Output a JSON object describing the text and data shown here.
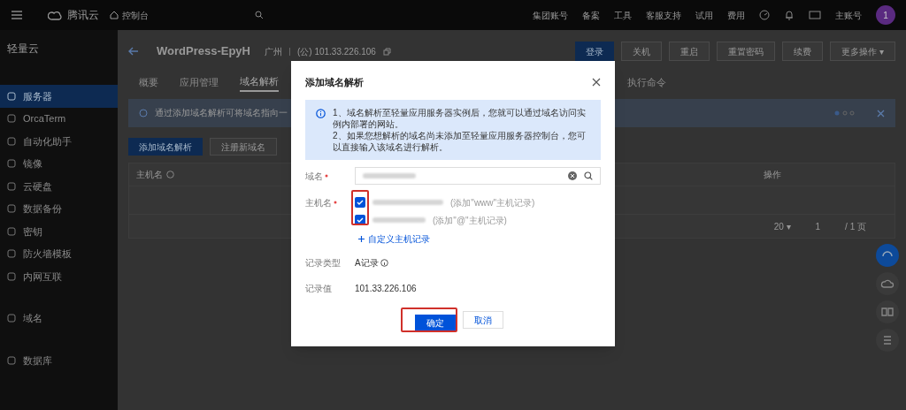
{
  "topbar": {
    "logo": "腾讯云",
    "console": "控制台",
    "nav": [
      "集团账号",
      "备案",
      "工具",
      "客服支持",
      "试用",
      "费用"
    ],
    "account": "主账号",
    "avatar": "1"
  },
  "sidebar": {
    "title": "轻量云",
    "items": [
      {
        "kind": "item",
        "label": "服务器",
        "selected": true
      },
      {
        "kind": "item",
        "label": "OrcaTerm",
        "selected": false
      },
      {
        "kind": "item",
        "label": "自动化助手",
        "selected": false
      },
      {
        "kind": "item",
        "label": "镜像",
        "selected": false
      },
      {
        "kind": "item",
        "label": "云硬盘",
        "selected": false
      },
      {
        "kind": "item",
        "label": "数据备份",
        "selected": false
      },
      {
        "kind": "item",
        "label": "密钥",
        "selected": false
      },
      {
        "kind": "item",
        "label": "防火墙模板",
        "selected": false
      },
      {
        "kind": "item",
        "label": "内网互联",
        "selected": false
      },
      {
        "kind": "section"
      },
      {
        "kind": "item",
        "label": "域名",
        "selected": false
      },
      {
        "kind": "section"
      },
      {
        "kind": "item",
        "label": "数据库",
        "selected": false
      }
    ]
  },
  "instance": {
    "name": "WordPress-EpyH",
    "region": "广州",
    "ip": "(公) 101.33.226.106"
  },
  "actions": [
    {
      "label": "登录",
      "primary": true
    },
    {
      "label": "关机",
      "primary": false
    },
    {
      "label": "重启",
      "primary": false
    },
    {
      "label": "重置密码",
      "primary": false
    },
    {
      "label": "续费",
      "primary": false
    },
    {
      "label": "更多操作 ▾",
      "primary": false
    }
  ],
  "tabs": [
    {
      "label": "概要",
      "selected": false
    },
    {
      "label": "应用管理",
      "selected": false
    },
    {
      "label": "域名解析",
      "selected": true
    },
    {
      "label": "执行命令",
      "selected": false
    }
  ],
  "banner": {
    "text": "通过添加域名解析可将域名指向一"
  },
  "toolbar": [
    {
      "label": "添加域名解析",
      "primary": true
    },
    {
      "label": "注册新域名",
      "primary": false
    }
  ],
  "table": {
    "columns": [
      "主机名",
      "操作"
    ],
    "pagination": {
      "page_size": "20 ▾",
      "page": "1",
      "pages": "/ 1 页"
    }
  },
  "dialog": {
    "title": "添加域名解析",
    "info": [
      "1、域名解析至轻量应用服务器实例后，您就可以通过域名访问实例内部署的网站。",
      "2、如果您想解析的域名尚未添加至轻量应用服务器控制台，您可以直接输入该域名进行解析。"
    ],
    "domain_label": "域名",
    "host_label": "主机名",
    "hosts": [
      {
        "checked": true,
        "hint": "(添加\"www\"主机记录)"
      },
      {
        "checked": true,
        "hint": "(添加\"@\"主机记录)"
      }
    ],
    "custom_host": "自定义主机记录",
    "type_label": "记录类型",
    "type_value": "A记录",
    "value_label": "记录值",
    "value": "101.33.226.106",
    "ok": "确定",
    "cancel": "取消"
  }
}
